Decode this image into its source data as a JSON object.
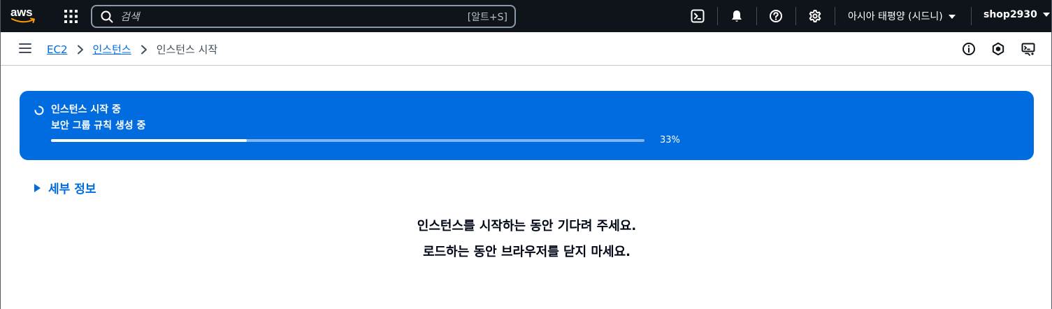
{
  "topnav": {
    "logo_text": "aws",
    "search": {
      "placeholder": "검색",
      "shortcut": "[알트+S]"
    },
    "icons": [
      "cloudshell-icon",
      "bell-icon",
      "help-icon",
      "gear-icon"
    ],
    "region": "아시아 태평양 (시드니)",
    "account": "shop2930"
  },
  "breadcrumb": {
    "items": [
      {
        "label": "EC2"
      },
      {
        "label": "인스턴스"
      },
      {
        "label": "인스턴스 시작"
      }
    ]
  },
  "flash": {
    "title": "인스턴스 시작 중",
    "description": "보안 그룹 규칙 생성 중",
    "progress": 33,
    "progress_label": "33%",
    "color": "#006ce0"
  },
  "details": {
    "label": "세부 정보"
  },
  "messages": {
    "line1": "인스턴스를 시작하는 동안 기다려 주세요.",
    "line2": "로드하는 동안 브라우저를 닫지 마세요."
  }
}
